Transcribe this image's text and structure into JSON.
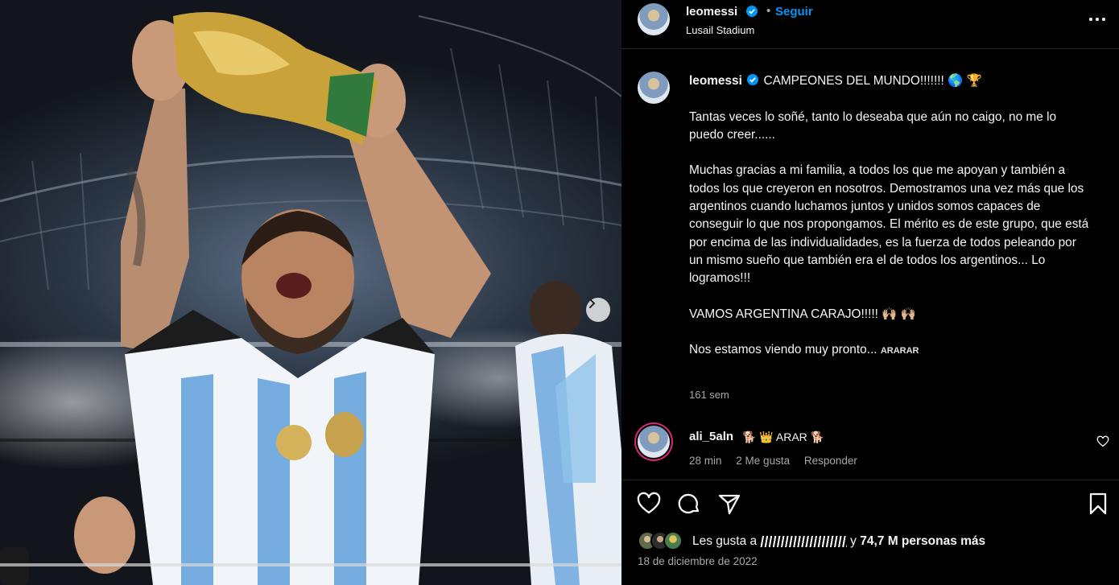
{
  "colors": {
    "accent_link": "#0095f6",
    "verified_badge": "#0095f6",
    "background": "#000000",
    "text_primary": "#f5f5f5",
    "text_secondary": "#a8a8a8",
    "story_ring": "#d62976"
  },
  "icons": {
    "next_photo": "chevron-right-icon",
    "more": "more-horizontal-icon",
    "like": "heart-icon",
    "comment": "comment-bubble-icon",
    "share": "paper-plane-icon",
    "save": "bookmark-icon",
    "verified": "verified-badge-icon",
    "comment_like": "heart-small-icon"
  },
  "post": {
    "header": {
      "username": "leomessi",
      "separator": "•",
      "follow_label": "Seguir",
      "location": "Lusail Stadium"
    },
    "caption": {
      "username": "leomessi",
      "headline": "CAMPEONES DEL MUNDO!!!!!!! 🌎 🏆",
      "paragraph1": "Tantas veces lo soñé, tanto lo deseaba que aún no caigo, no me lo puedo creer......",
      "paragraph2": "Muchas gracias a mi familia, a todos los que me apoyan y también a todos los que creyeron en nosotros. Demostramos una vez más que los argentinos cuando luchamos juntos y unidos somos capaces de conseguir lo que nos propongamos. El mérito es de este grupo, que está por encima de las individualidades, es la fuerza de todos peleando por un mismo sueño que también era el de todos los argentinos... Lo logramos!!!",
      "paragraph3": "VAMOS ARGENTINA CARAJO!!!!! 🙌🏼 🙌🏼",
      "paragraph4": "Nos estamos viendo muy pronto...",
      "paragraph4_tag": "ARARAR",
      "time": "161 sem"
    },
    "comments": [
      {
        "username": "ali_5aln",
        "text": "🐕 👑 ARAR 🐕",
        "time": "28 min",
        "likes": "2 Me gusta",
        "reply_label": "Responder"
      }
    ],
    "likes": {
      "prefix": "Les gusta a",
      "connector": "y",
      "count_text": "74,7 M personas más"
    },
    "date": "18 de diciembre de 2022"
  }
}
